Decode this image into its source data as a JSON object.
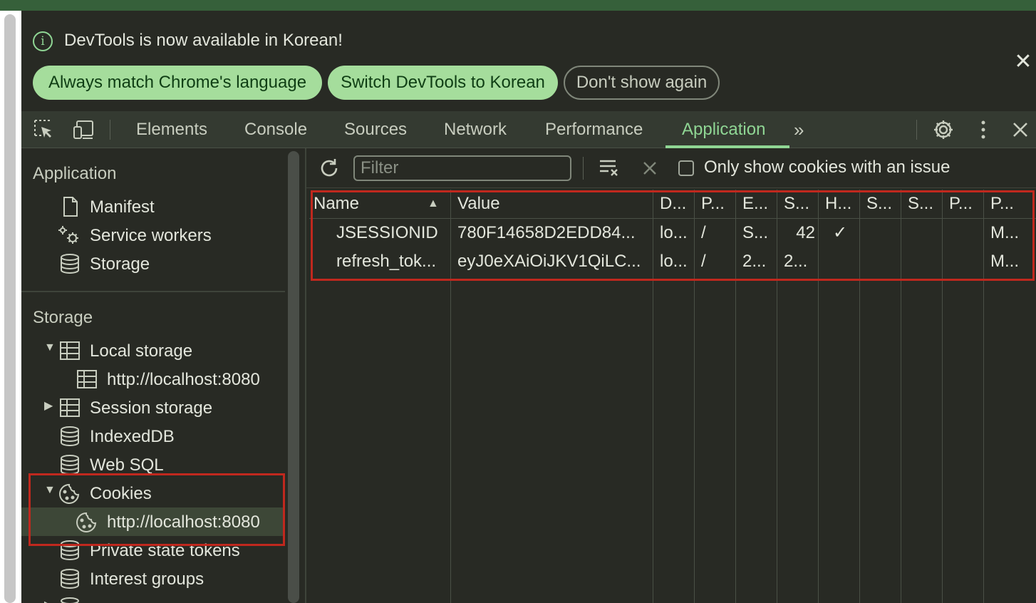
{
  "infobar": {
    "icon": "info-icon",
    "message": "DevTools is now available in Korean!",
    "buttons": [
      "Always match Chrome's language",
      "Switch DevTools to Korean",
      "Don't show again"
    ]
  },
  "toolbar": {
    "tabs": [
      "Elements",
      "Console",
      "Sources",
      "Network",
      "Performance",
      "Application"
    ],
    "active_tab": "Application",
    "more": "»"
  },
  "sidebar": {
    "application_header": "Application",
    "application_items": [
      "Manifest",
      "Service workers",
      "Storage"
    ],
    "storage_header": "Storage",
    "local_storage": "Local storage",
    "local_storage_origin": "http://localhost:8080",
    "session_storage": "Session storage",
    "indexeddb": "IndexedDB",
    "web_sql": "Web SQL",
    "cookies": "Cookies",
    "cookies_origin": "http://localhost:8080",
    "private_state_tokens": "Private state tokens",
    "interest_groups": "Interest groups"
  },
  "cookies_panel": {
    "filter_placeholder": "Filter",
    "only_issues_label": "Only show cookies with an issue",
    "only_issues_checked": false,
    "columns": [
      "Name",
      "Value",
      "D...",
      "P...",
      "E...",
      "S...",
      "H...",
      "S...",
      "S...",
      "P...",
      "P..."
    ],
    "sort_indicator": "▲",
    "rows": [
      {
        "name": "JSESSIONID",
        "value": "780F14658D2EDD84...",
        "domain": "lo...",
        "path": "/",
        "expires": "S...",
        "size": "42",
        "httponly": "✓",
        "secure": "",
        "samesite": "",
        "partition_key": "",
        "priority": "M..."
      },
      {
        "name": "refresh_tok...",
        "value": "eyJ0eXAiOiJKV1QiLC...",
        "domain": "lo...",
        "path": "/",
        "expires": "2...",
        "size": "2...",
        "httponly": "",
        "secure": "",
        "samesite": "",
        "partition_key": "",
        "priority": "M..."
      }
    ]
  },
  "colors": {
    "accent": "#8fd694",
    "highlight_box": "#c0281e",
    "panel_bg": "#282a24"
  }
}
